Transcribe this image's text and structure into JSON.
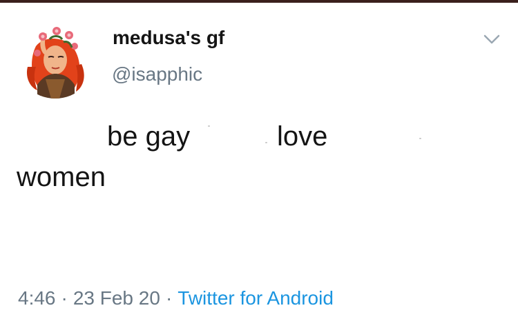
{
  "tweet": {
    "display_name": "medusa's gf",
    "handle": "@isapphic",
    "text_words": [
      "be gay",
      "love",
      "women"
    ],
    "time": "4:46",
    "date": "23 Feb 20",
    "separator": "·",
    "source": "Twitter for Android"
  },
  "icons": {
    "menu": "chevron-down-icon",
    "avatar": "avatar-illustration"
  },
  "colors": {
    "text": "#141414",
    "secondary": "#687784",
    "link": "#1b95e0",
    "top_rule": "#3a1f1c"
  }
}
